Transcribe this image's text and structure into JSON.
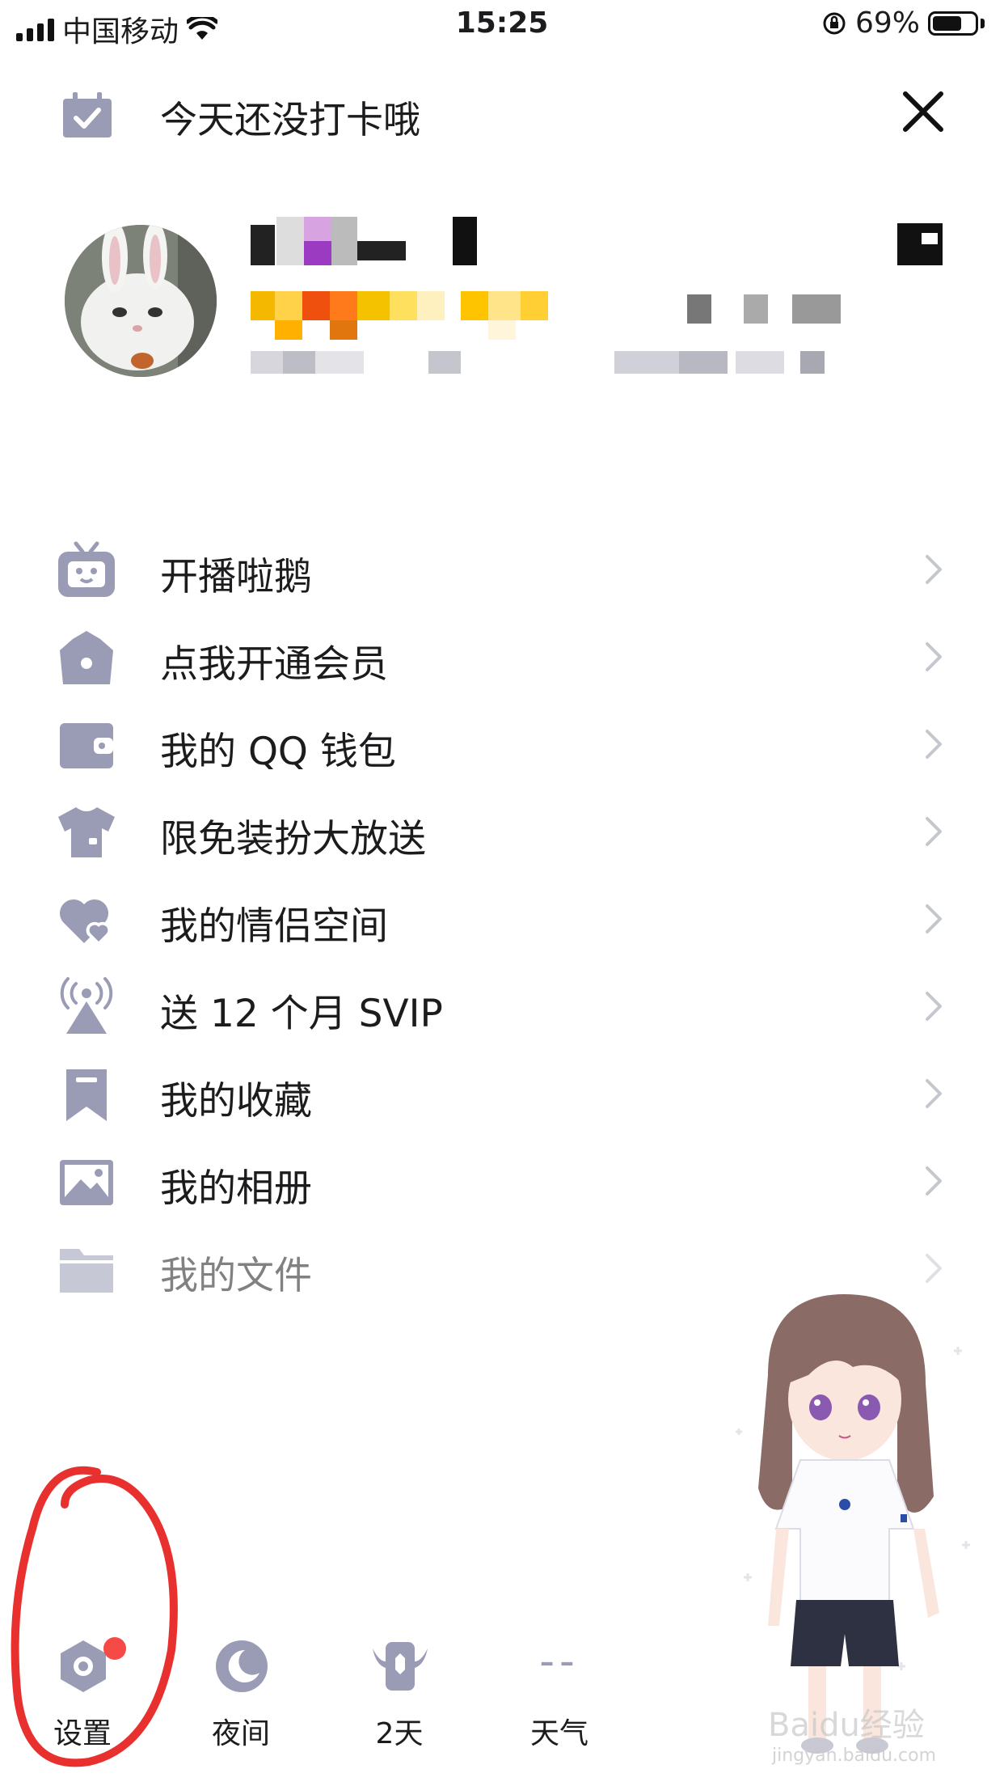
{
  "status_bar": {
    "carrier": "中国移动",
    "time": "15:25",
    "battery": "69%",
    "battery_level": 0.69
  },
  "checkin": {
    "label": "今天还没打卡哦"
  },
  "menu": {
    "items": [
      {
        "label": "开播啦鹅",
        "icon": "tv-icon"
      },
      {
        "label": "点我开通会员",
        "icon": "crown-icon"
      },
      {
        "label": "我的 QQ 钱包",
        "icon": "wallet-icon"
      },
      {
        "label": "限免装扮大放送",
        "icon": "shirt-icon"
      },
      {
        "label": "我的情侣空间",
        "icon": "heart-icon"
      },
      {
        "label": "送 12 个月 SVIP",
        "icon": "broadcast-icon"
      },
      {
        "label": "我的收藏",
        "icon": "bookmark-icon"
      },
      {
        "label": "我的相册",
        "icon": "photo-icon"
      },
      {
        "label": "我的文件",
        "icon": "folder-icon"
      }
    ]
  },
  "tabbar": {
    "settings": "设置",
    "night": "夜间",
    "days": "2天",
    "weather": "天气",
    "weather_value": "--"
  },
  "watermark": {
    "brand": "Baidu经验",
    "url": "jingyan.baidu.com"
  },
  "colors": {
    "icon": "#9a9cb5",
    "chevron": "#c5c7cf",
    "badge": "#f54a45",
    "annotation": "#e8312f"
  }
}
